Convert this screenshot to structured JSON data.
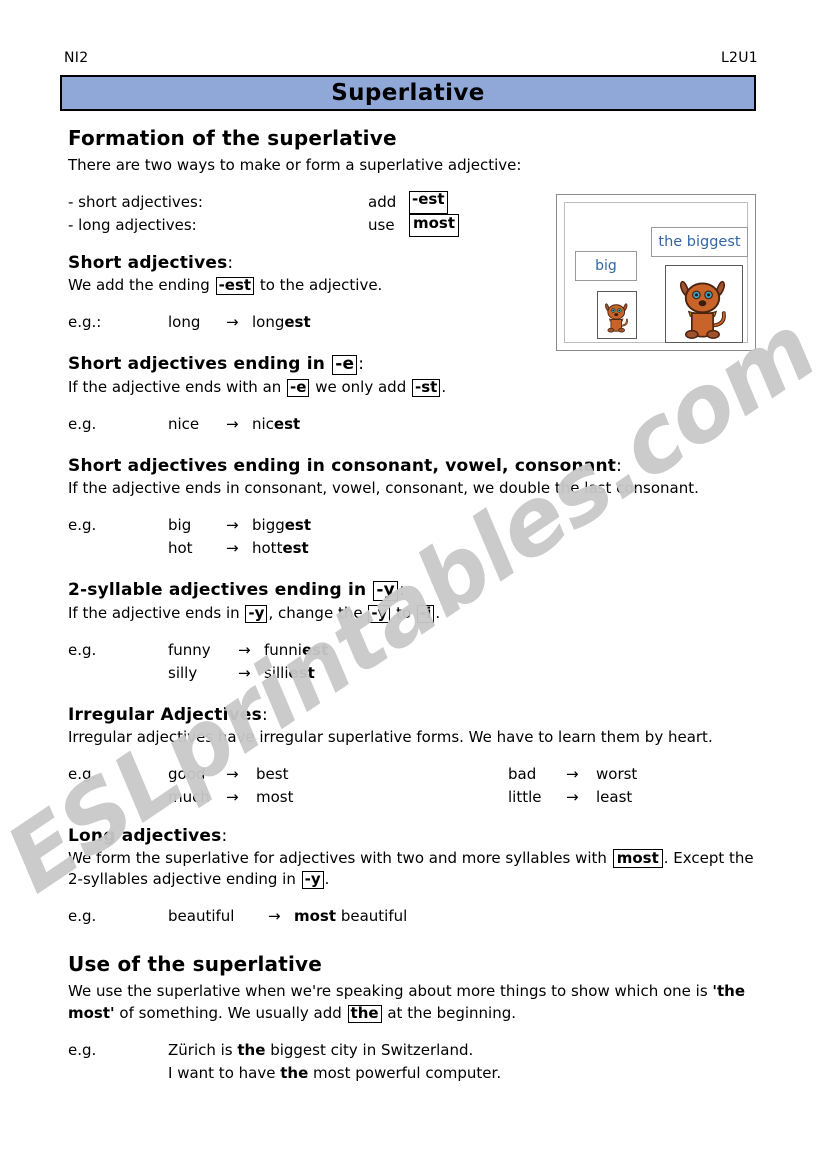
{
  "header": {
    "left_code": "NI2",
    "right_code": "L2U1"
  },
  "banner": {
    "title": "Superlative",
    "bg_color": "#8fa8d8",
    "border_color": "#000000"
  },
  "watermark": {
    "text": "ESLprintables.com",
    "color": "#c9c9c9"
  },
  "sections": {
    "formation": {
      "heading": "Formation of the superlative",
      "intro": "There are two ways to make or form a superlative adjective:",
      "rules": [
        {
          "label": "- short adjectives:",
          "verb": "add",
          "token": "-est"
        },
        {
          "label": "- long adjectives:",
          "verb": "use",
          "token": "most"
        }
      ]
    },
    "short_adjectives": {
      "heading": "Short adjectives",
      "heading_colon": ":",
      "rule_before": "We add the ending ",
      "rule_token": "-est",
      "rule_after": " to the adjective.",
      "eg_label": "e.g.:",
      "examples": [
        {
          "base": "long",
          "arrow": "→",
          "result_plain": "long",
          "result_bold": "est"
        }
      ]
    },
    "ending_e": {
      "heading": "Short adjectives ending in ",
      "heading_token": "-e",
      "heading_colon": ":",
      "rule_p1": "If the adjective ends with an ",
      "rule_t1": "-e",
      "rule_p2": " we only add ",
      "rule_t2": "-st",
      "rule_p3": ".",
      "eg_label": "e.g.",
      "examples": [
        {
          "base": "nice",
          "arrow": "→",
          "result_plain": "nic",
          "result_bold": "est"
        }
      ]
    },
    "cvc": {
      "heading": "Short adjectives ending in consonant, vowel, consonant",
      "heading_colon": ":",
      "rule": "If the adjective ends in consonant, vowel, consonant, we double the last consonant.",
      "eg_label": "e.g.",
      "examples": [
        {
          "base": "big",
          "arrow": "→",
          "result_plain": "bigg",
          "result_bold": "est"
        },
        {
          "base": "hot",
          "arrow": "→",
          "result_plain": "hott",
          "result_bold": "est"
        }
      ]
    },
    "two_syllable_y": {
      "heading": "2-syllable adjectives ending in ",
      "heading_token": "-y",
      "heading_colon": ":",
      "rule_p1": "If the adjective ends in ",
      "rule_t1": "-y",
      "rule_p2": ", change the ",
      "rule_t2": "-y",
      "rule_p3": " to ",
      "rule_t3": "-i",
      "rule_p4": ".",
      "eg_label": "e.g.",
      "examples": [
        {
          "base": "funny",
          "arrow": "→",
          "result_plain": "funni",
          "result_bold": "est"
        },
        {
          "base": "silly",
          "arrow": "→",
          "result_plain": "silli",
          "result_bold": "est"
        }
      ]
    },
    "irregular": {
      "heading": "Irregular Adjectives",
      "heading_colon": ":",
      "rule": "Irregular adjectives have irregular superlative forms. We have to learn them by heart.",
      "eg_label": "e.g.",
      "left_column": [
        {
          "base": "good",
          "arrow": "→",
          "result": "best"
        },
        {
          "base": "much",
          "arrow": "→",
          "result": "most"
        }
      ],
      "right_column": [
        {
          "base": "bad",
          "arrow": "→",
          "result": "worst"
        },
        {
          "base": "little",
          "arrow": "→",
          "result": "least"
        }
      ]
    },
    "long_adjectives": {
      "heading": "Long adjectives",
      "heading_colon": ":",
      "rule_p1": "We form the superlative for adjectives with two and more syllables with ",
      "rule_t1": "most",
      "rule_p2": ". Except the 2-syllables adjective ending in ",
      "rule_t2": "-y",
      "rule_p3": ".",
      "eg_label": "e.g.",
      "examples": [
        {
          "base": "beautiful",
          "arrow": "→",
          "result_bold": "most",
          "result_plain": " beautiful"
        }
      ]
    },
    "use": {
      "heading": "Use of the superlative",
      "rule_p1": "We use the superlative when we're speaking about more things to show which one is ",
      "rule_b1": "'the most'",
      "rule_p2": " of something. We usually add ",
      "rule_t1": "the",
      "rule_p3": " at the beginning.",
      "eg_label": "e.g.",
      "sentences": [
        {
          "p1": "Zürich is ",
          "b": "the",
          "p2": " biggest city in Switzerland."
        },
        {
          "p1": "I want to have ",
          "b": "the",
          "p2": " most powerful computer."
        }
      ]
    }
  },
  "illustration": {
    "label_small": "big",
    "label_large": "the biggest",
    "label_color": "#3465a4",
    "dog_alt_small": "small-brown-cartoon-dog",
    "dog_alt_large": "large-brown-cartoon-dog"
  }
}
